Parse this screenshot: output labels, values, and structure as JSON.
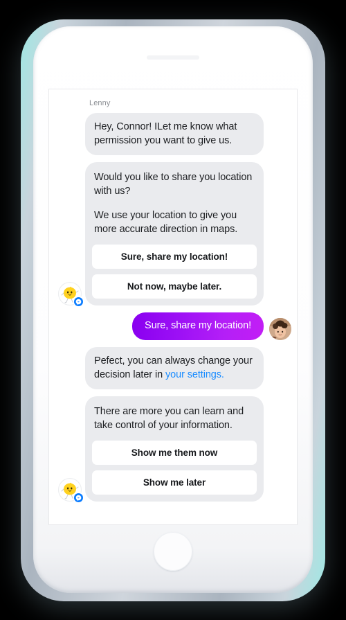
{
  "device": {
    "type": "smartphone-mockup",
    "frame_color": "#ffffff",
    "edge_highlight_color": "#9fe8e4"
  },
  "screen": {
    "background": "#ffffff",
    "app": "messenger-chat"
  },
  "chat": {
    "sender_name": "Lenny",
    "bubble_color": "#eaebee",
    "outgoing_gradient_start": "#8a00f0",
    "outgoing_gradient_end": "#c21ef5",
    "link_color": "#1a8cff",
    "badge_color": "#0a7cff",
    "messages": [
      {
        "id": "msg-1",
        "direction": "incoming",
        "paragraphs": [
          "Hey, Connor! ILet me know what permission you want to give us."
        ],
        "buttons": []
      },
      {
        "id": "msg-2",
        "direction": "incoming",
        "paragraphs": [
          "Would you like to share you location with us?",
          "We use your location to give you more accurate direction in maps."
        ],
        "buttons": [
          "Sure, share my location!",
          "Not now, maybe later."
        ]
      },
      {
        "id": "msg-3",
        "direction": "outgoing",
        "text": "Sure, share my location!"
      },
      {
        "id": "msg-4",
        "direction": "incoming",
        "text_before_link": "Pefect, you can always change your decision later in ",
        "link_text": "your settings.",
        "buttons": []
      },
      {
        "id": "msg-5",
        "direction": "incoming",
        "paragraphs": [
          "There are more you can learn and take control of your information."
        ],
        "buttons": [
          "Show me them now",
          "Show me later"
        ]
      }
    ]
  },
  "avatars": {
    "bot_name": "lemon-character-avatar",
    "bot_badge": "messenger-badge",
    "user_name": "user-photo-avatar"
  }
}
